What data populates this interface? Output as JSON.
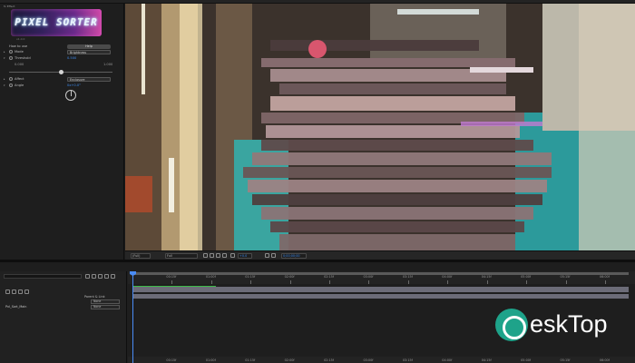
{
  "panel": {
    "title": "fx Effect",
    "logo_text": "PIXEL SORTER",
    "logo_sub": "v1.0.0",
    "how_to_use": "How to use",
    "help_button": "Help",
    "mode_label": "Mode",
    "mode_value": "Brightness",
    "threshold_label": "Threshold",
    "threshold_value": "0.500",
    "threshold_min": "0.000",
    "threshold_max": "1.000",
    "threshold_level": 0.5,
    "affect_label": "Affect",
    "affect_value": "Enclosure",
    "angle_label": "Angle",
    "angle_value": "0x+0.0°"
  },
  "viewer_bar": {
    "zoom": "(Full)",
    "res": "Full",
    "timecode": "0;00;00;00",
    "angle_readout": "+0.0"
  },
  "timeline": {
    "parent_link_header": "Parent & Link",
    "layer_name": "Pxl_Sort_Main",
    "parent_1": "None",
    "parent_2": "None",
    "ticks": [
      "0f",
      "00:15f",
      "01:00f",
      "01:15f",
      "02:00f",
      "02:15f",
      "03:00f",
      "03:15f",
      "04:00f",
      "04:15f",
      "05:00f",
      "05:15f",
      "06:00f"
    ]
  },
  "watermark": {
    "text": "eskTop"
  },
  "colors": {
    "accent_blue": "#3d8cf0",
    "work_area_green": "#3bbb47",
    "watermark_teal": "#1ea38a"
  }
}
